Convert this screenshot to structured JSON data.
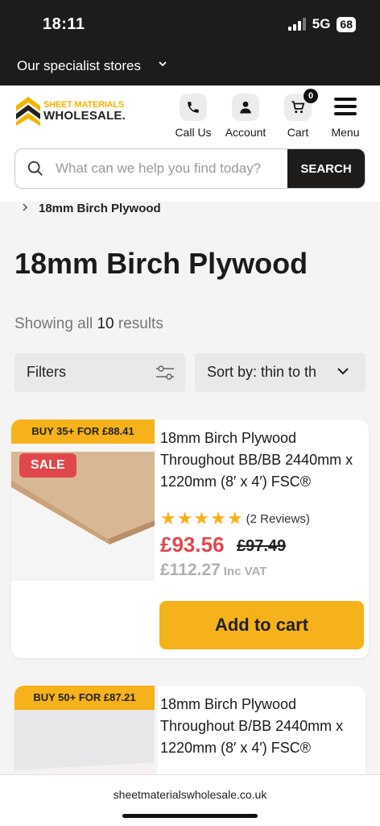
{
  "status": {
    "time": "18:11",
    "network": "5G",
    "battery": "68"
  },
  "stores": {
    "label": "Our specialist stores"
  },
  "logo": {
    "line1": "SHEET MATERIALS",
    "line2": "WHOLESALE."
  },
  "header": {
    "call_label": "Call Us",
    "account_label": "Account",
    "cart_label": "Cart",
    "cart_count": "0",
    "menu_label": "Menu"
  },
  "search": {
    "placeholder": "What can we help you find today?",
    "button_label": "SEARCH"
  },
  "breadcrumb": {
    "current": "18mm Birch Plywood"
  },
  "page": {
    "title": "18mm Birch Plywood",
    "results_prefix": "Showing all ",
    "results_count": "10",
    "results_suffix": " results"
  },
  "toolbar": {
    "filters_label": "Filters",
    "sort_label": "Sort by: thin to th"
  },
  "products": [
    {
      "bulk_offer": "BUY 35+ FOR £88.41",
      "sale_label": "SALE",
      "title": "18mm Birch Plywood Throughout BB/BB 2440mm x 1220mm (8′ x 4′) FSC®",
      "rating": 5,
      "reviews": "(2 Reviews)",
      "price": "£93.56",
      "was_price": "£97.49",
      "inc_vat_price": "£112.27",
      "inc_vat_label": "Inc VAT",
      "add_to_cart": "Add to cart"
    },
    {
      "bulk_offer": "BUY 50+ FOR £87.21",
      "title": "18mm Birch Plywood Throughout B/BB 2440mm x 1220mm (8′ x 4′) FSC®"
    }
  ],
  "browser": {
    "url": "sheetmaterialswholesale.co.uk"
  },
  "colors": {
    "accent": "#f6b21a",
    "sale": "#e0474c",
    "dark": "#1e1b1b"
  }
}
